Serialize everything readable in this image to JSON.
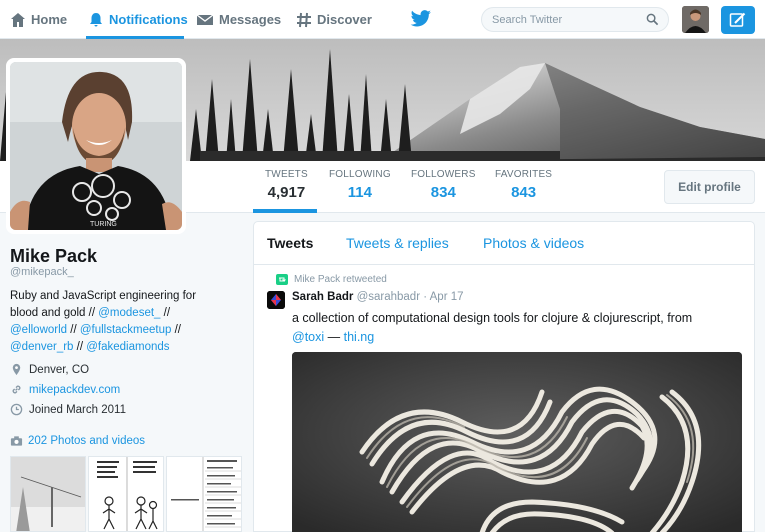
{
  "nav": {
    "home": "Home",
    "notifications": "Notifications",
    "messages": "Messages",
    "discover": "Discover"
  },
  "search": {
    "placeholder": "Search Twitter"
  },
  "stats": [
    {
      "label": "TWEETS",
      "value": "4,917"
    },
    {
      "label": "FOLLOWING",
      "value": "114"
    },
    {
      "label": "FOLLOWERS",
      "value": "834"
    },
    {
      "label": "FAVORITES",
      "value": "843"
    }
  ],
  "edit_profile": "Edit profile",
  "profile": {
    "name": "Mike Pack",
    "handle": "@mikepack_",
    "bio_text": "Ruby and JavaScript engineering for blood and gold // ",
    "bio_links": [
      "@modeset_",
      "@elloworld",
      "@fullstackmeetup",
      "@denver_rb",
      "@fakediamonds"
    ],
    "location": "Denver, CO",
    "website": "mikepackdev.com",
    "joined": "Joined March 2011",
    "photos": "202 Photos and videos"
  },
  "timeline": {
    "tabs": [
      "Tweets",
      "Tweets & replies",
      "Photos & videos"
    ],
    "retweet_label": "Mike Pack retweeted",
    "tweet": {
      "author_name": "Sarah Badr",
      "author_handle": "@sarahbadr",
      "separator": "·",
      "date": "Apr 17",
      "text": "a collection of computational design tools for clojure & clojurescript, from",
      "mention": "@toxi",
      "dash": "—",
      "link": "thi.ng"
    }
  },
  "colors": {
    "accent": "#1b95e0",
    "text": "#14171a",
    "muted": "#8899a6"
  }
}
